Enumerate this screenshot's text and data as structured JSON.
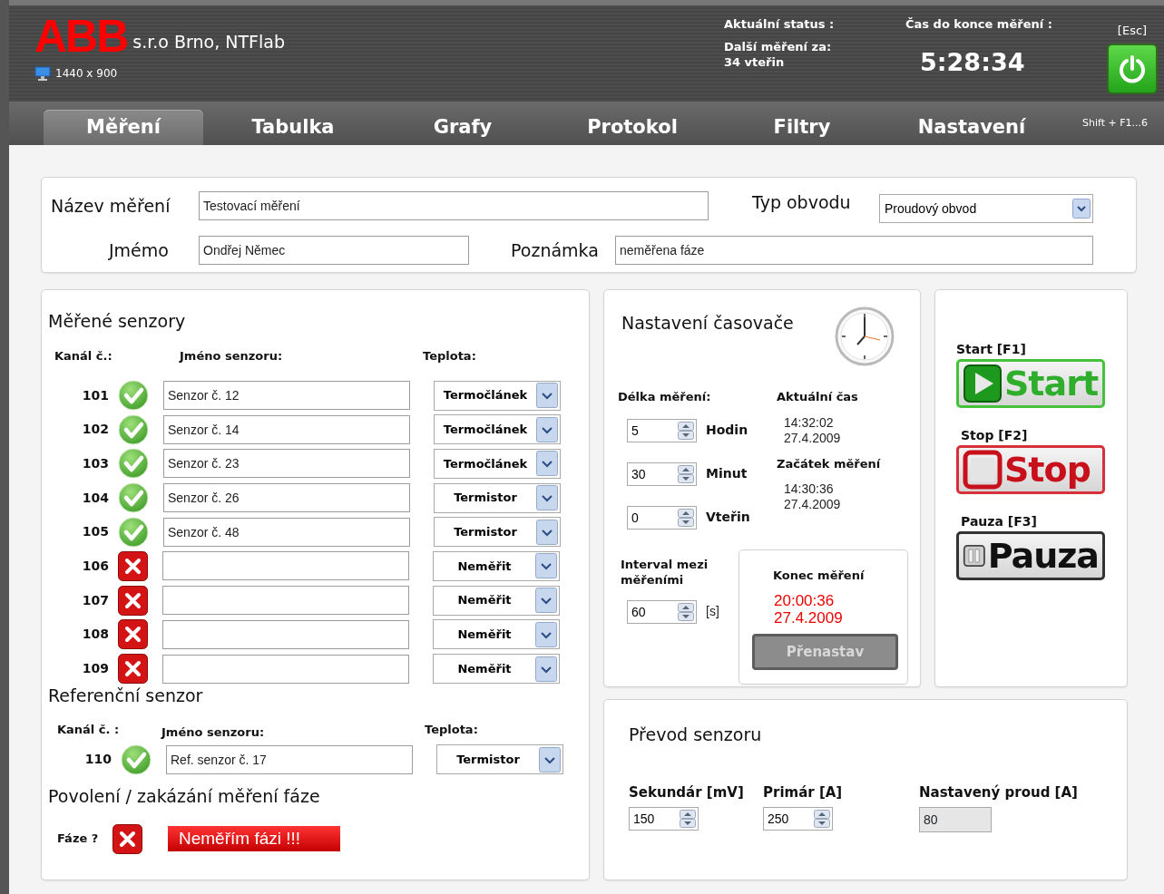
{
  "header": {
    "logo": "ABB",
    "company": "s.r.o Brno, NTFlab",
    "resolution": "1440 x 900",
    "status_label": "Aktuální status :",
    "next_label": "Další měření za:",
    "next_value": "34  vteřin",
    "countdown_label": "Čas do konce měření :",
    "countdown": "5:28:34",
    "esc_hint": "[Esc]"
  },
  "tabs": [
    {
      "label": "Měření",
      "selected": true
    },
    {
      "label": "Tabulka",
      "selected": false
    },
    {
      "label": "Grafy",
      "selected": false
    },
    {
      "label": "Protokol",
      "selected": false
    },
    {
      "label": "Filtry",
      "selected": false
    },
    {
      "label": "Nastavení",
      "selected": false
    }
  ],
  "tabs_hint": "Shift + F1...6",
  "measurement": {
    "name_label": "Název měření",
    "name_value": "Testovací měření",
    "circuit_label": "Typ obvodu",
    "circuit_value": "Proudový obvod",
    "person_label": "Jmémo",
    "person_value": "Ondřej Němec",
    "note_label": "Poznámka",
    "note_value": "neměřena fáze"
  },
  "sensors": {
    "title": "Měřené senzory",
    "columns": [
      "Kanál č.:",
      "Jméno senzoru:",
      "Teplota:"
    ],
    "rows": [
      {
        "channel": "101",
        "active": true,
        "name": "Senzor č. 12",
        "type": "Termočlánek"
      },
      {
        "channel": "102",
        "active": true,
        "name": "Senzor č. 14",
        "type": "Termočlánek"
      },
      {
        "channel": "103",
        "active": true,
        "name": "Senzor č. 23",
        "type": "Termočlánek"
      },
      {
        "channel": "104",
        "active": true,
        "name": "Senzor č. 26",
        "type": "Termistor"
      },
      {
        "channel": "105",
        "active": true,
        "name": "Senzor č. 48",
        "type": "Termistor"
      },
      {
        "channel": "106",
        "active": false,
        "type": "Neměřit"
      },
      {
        "channel": "107",
        "active": false,
        "type": "Neměřit"
      },
      {
        "channel": "108",
        "active": false,
        "type": "Neměřit"
      },
      {
        "channel": "109",
        "active": false,
        "type": "Neměřit"
      }
    ]
  },
  "reference": {
    "title": "Referenční senzor",
    "columns": [
      "Kanál č. :",
      "Jméno senzoru:",
      "Teplota:"
    ],
    "row": {
      "channel": "110",
      "active": true,
      "name": "Ref. senzor č. 17",
      "type": "Termistor"
    }
  },
  "phase": {
    "title": "Povolení / zakázání měření fáze",
    "label": "Fáze ?",
    "active": false,
    "message": "Neměřím fázi !!!"
  },
  "timer": {
    "title": "Nastavení časovače",
    "length_label": "Délka měření:",
    "length_fields": [
      {
        "value": "5",
        "unit": "Hodin"
      },
      {
        "value": "30",
        "unit": "Minut"
      },
      {
        "value": "0",
        "unit": "Vteřin"
      }
    ],
    "interval_label": "Interval mezi měřeními",
    "interval_value": "60",
    "interval_unit": "[s]",
    "current_label": "Aktuální čas",
    "current_time": "14:32:02",
    "current_date": "27.4.2009",
    "start_label": "Začátek měření",
    "start_time": "14:30:36",
    "start_date": "27.4.2009",
    "end_label": "Konec měření",
    "end_time": "20:00:36",
    "end_date": "27.4.2009",
    "button": {
      "label": "Přenastav",
      "disabled": true
    }
  },
  "controls": [
    {
      "kind": "start",
      "hint": "Start [F1]",
      "label": "Start"
    },
    {
      "kind": "stop",
      "hint": "Stop [F2]",
      "label": "Stop"
    },
    {
      "kind": "pause",
      "hint": "Pauza [F3]",
      "label": "Pauza"
    }
  ],
  "conversion": {
    "title": "Převod senzoru",
    "fields": [
      {
        "kind": "spin",
        "label": "Sekundár [mV]",
        "value": "150"
      },
      {
        "kind": "spin",
        "label": "Primár [A]",
        "value": "250"
      },
      {
        "kind": "readonly",
        "label": "Nastavený proud [A]",
        "value": "80"
      }
    ]
  }
}
